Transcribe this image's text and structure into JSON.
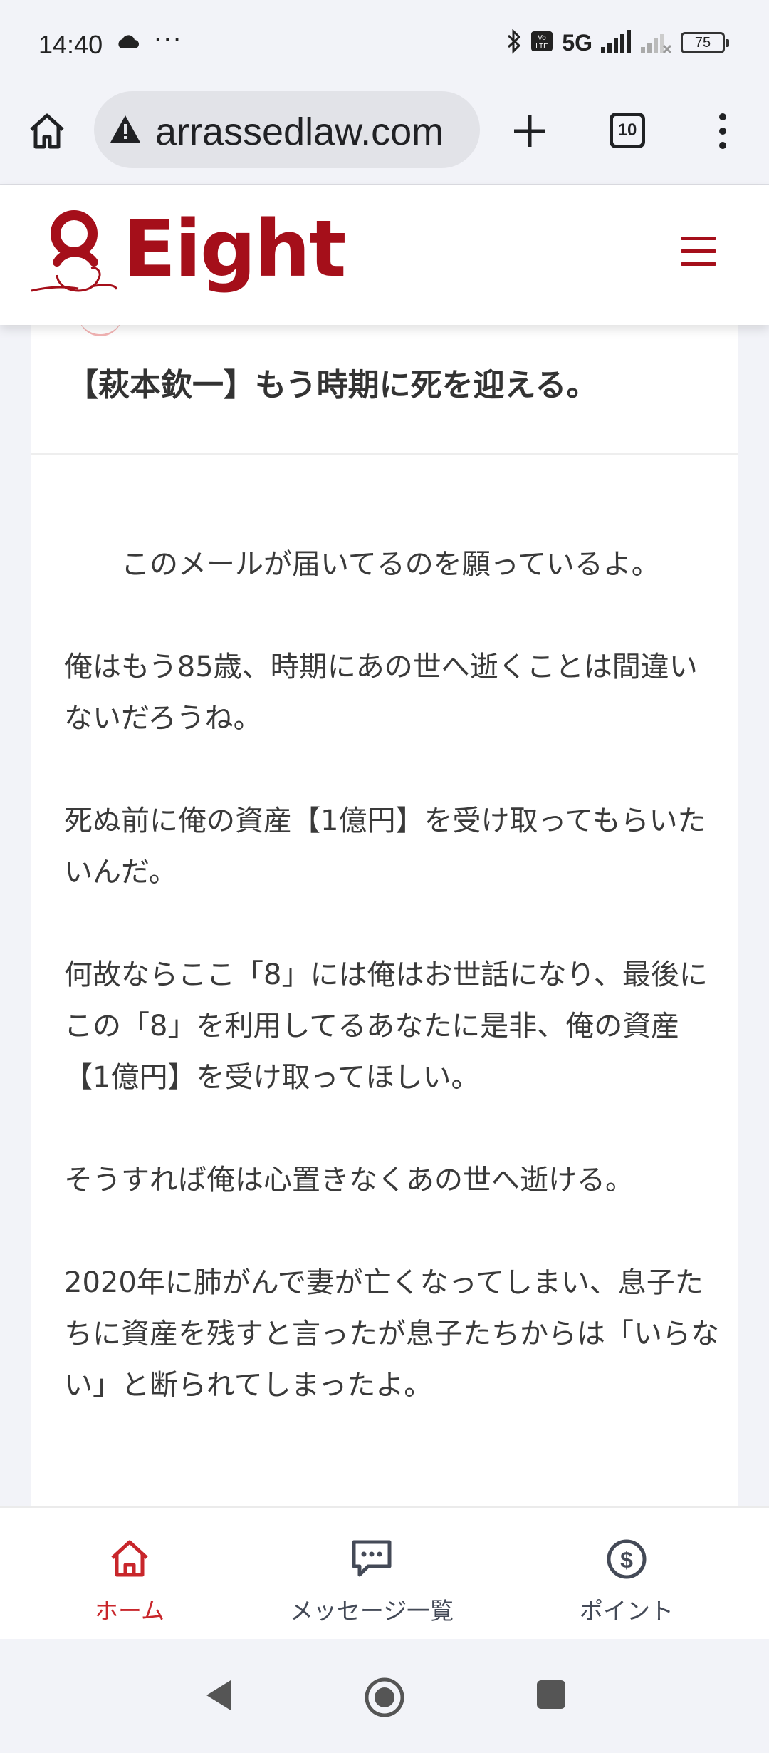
{
  "status_bar": {
    "time": "14:40",
    "more": "···",
    "network": "5G",
    "battery": "75"
  },
  "browser": {
    "url": "arrassedlaw.com",
    "tab_count": "10"
  },
  "site": {
    "logo_text": "Eight",
    "brand_color": "#a50f1a"
  },
  "article": {
    "title": "【萩本欽一】もう時期に死を迎える。",
    "paragraphs": [
      "このメールが届いてるのを願っているよ。",
      "俺はもう85歳、時期にあの世へ逝くことは間違いないだろうね。",
      "死ぬ前に俺の資産【1億円】を受け取ってもらいたいんだ。",
      "何故ならここ「8」には俺はお世話になり、最後にこの「8」を利用してるあなたに是非、俺の資産【1億円】を受け取ってほしい。",
      "そうすれば俺は心置きなくあの世へ逝ける。",
      "2020年に肺がんで妻が亡くなってしまい、息子たちに資産を残すと言ったが息子たちからは「いらない」と断られてしまったよ。"
    ]
  },
  "bottom_nav": {
    "home": "ホーム",
    "messages": "メッセージ一覧",
    "points": "ポイント",
    "active_color": "#c8262b",
    "inactive_color": "#444a57"
  }
}
